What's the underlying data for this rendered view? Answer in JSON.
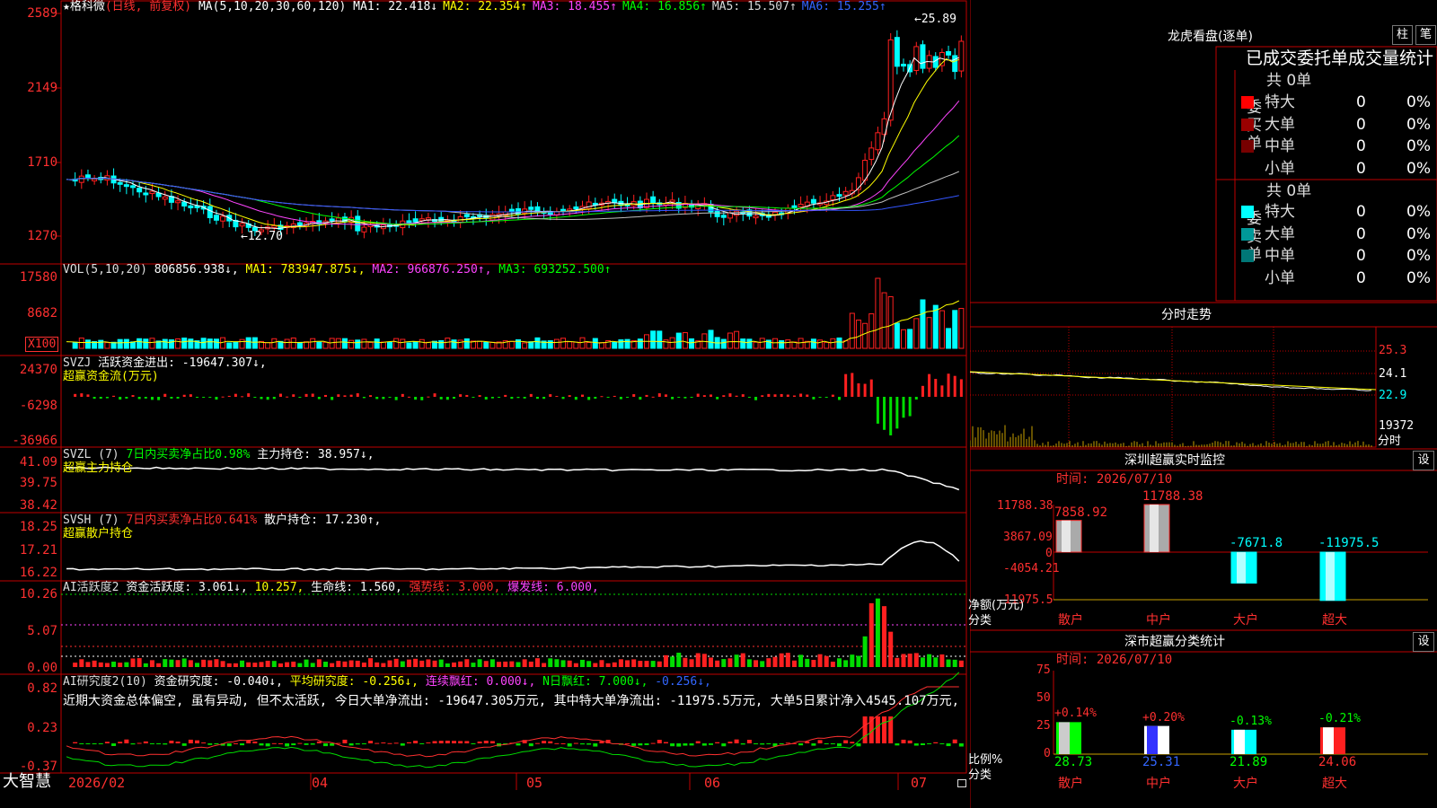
{
  "main": {
    "title": "★格科微",
    "mode": "(日线, 前复权)",
    "ma_params": "MA(5,10,20,30,60,120)",
    "ma": [
      {
        "label": "MA1: 22.418↓",
        "color": "#ffffff"
      },
      {
        "label": "MA2: 22.354↑",
        "color": "#ffff00"
      },
      {
        "label": "MA3: 18.455↑",
        "color": "#ff44ff"
      },
      {
        "label": "MA4: 16.856↑",
        "color": "#00ff00"
      },
      {
        "label": "MA5: 15.507↑",
        "color": "#d8d8d8"
      },
      {
        "label": "MA6: 15.255↑",
        "color": "#3366ff"
      }
    ],
    "axis": [
      "2589",
      "2149",
      "1710",
      "1270"
    ],
    "high_label": "←25.89",
    "low_label": "←12.70"
  },
  "vol": {
    "title": "VOL(5,10,20)",
    "value": "806856.938↓,",
    "ma1": "MA1: 783947.875↓,",
    "ma2": "MA2: 966876.250↑,",
    "ma3": "MA3: 693252.500↑",
    "axis": [
      "17580",
      "8682"
    ],
    "unit": "X100"
  },
  "svzj": {
    "title": "SVZJ",
    "text": "活跃资金进出: -19647.307↓,",
    "sub": "超赢资金流(万元)",
    "axis": [
      "24370",
      "-6298",
      "-36966"
    ]
  },
  "svzl": {
    "title": "SVZL (7)",
    "text1": "7日内买卖净占比0.98%",
    "text2": "主力持仓: 38.957↓,",
    "sub": "超赢主力持仓",
    "axis": [
      "41.09",
      "39.75",
      "38.42"
    ]
  },
  "svsh": {
    "title": "SVSH (7)",
    "text1": "7日内买卖净占比0.641%",
    "text2": "散户持仓: 17.230↑,",
    "sub": "超赢散户持仓",
    "axis": [
      "18.25",
      "17.21",
      "16.22"
    ]
  },
  "ai1": {
    "title": "AI活跃度2",
    "t1": "资金活跃度: 3.061↓,",
    "t2": "10.257,",
    "t3": "生命线: 1.560,",
    "t4": "强势线: 3.000,",
    "t5": "爆发线: 6.000,",
    "axis": [
      "10.26",
      "5.07",
      "0.00"
    ]
  },
  "ai2": {
    "title": "AI研究度2(10)",
    "t1": "资金研究度: -0.040↓,",
    "t2": "平均研究度: -0.256↓,",
    "t3": "连续飘红: 0.000↓,",
    "t4": "N日飘红: 7.000↓,",
    "t5": "-0.256↓,",
    "comment": "近期大资金总体偏空, 虽有异动, 但不太活跃, 今日大单净流出: -19647.305万元, 其中特大单净流出: -11975.5万元, 大单5日累计净入4545.107万元, ",
    "axis": [
      "0.82",
      "0.23",
      "-0.37"
    ]
  },
  "xaxis": [
    "2026/02",
    "04",
    "05",
    "06",
    "07"
  ],
  "brand": "大智慧",
  "lhb": {
    "title": "龙虎看盘(逐单)",
    "btn1": "柱",
    "btn2": "笔",
    "tabs": "已成交委托单成交量统计",
    "buy": {
      "side": "委买单",
      "total": "共 0单",
      "rows": [
        {
          "name": "特大",
          "count": "0",
          "pct": "0%",
          "color": "#ff0000"
        },
        {
          "name": "大单",
          "count": "0",
          "pct": "0%",
          "color": "#990000"
        },
        {
          "name": "中单",
          "count": "0",
          "pct": "0%",
          "color": "#770000"
        },
        {
          "name": "小单",
          "count": "0",
          "pct": "0%",
          "color": ""
        }
      ]
    },
    "sell": {
      "side": "委卖单",
      "total": "共 0单",
      "rows": [
        {
          "name": "特大",
          "count": "0",
          "pct": "0%",
          "color": "#00ffff"
        },
        {
          "name": "大单",
          "count": "0",
          "pct": "0%",
          "color": "#009999"
        },
        {
          "name": "中单",
          "count": "0",
          "pct": "0%",
          "color": "#007777"
        },
        {
          "name": "小单",
          "count": "0",
          "pct": "0%",
          "color": ""
        }
      ]
    }
  },
  "intraday": {
    "title": "分时走势",
    "axis": [
      "25.3",
      "24.1",
      "22.9",
      "19372"
    ],
    "unit": "分时"
  },
  "szmon": {
    "title": "深圳超赢实时监控",
    "btn": "设",
    "time": "时间: 2026/07/10",
    "yaxis": [
      "11788.38",
      "3867.09",
      "0",
      "-4054.21",
      "-11975.5"
    ],
    "ylabel": "净额(万元)",
    "xtitle": "分类",
    "cats": [
      "散户",
      "中户",
      "大户",
      "超大"
    ],
    "vals": [
      "7858.92",
      "11788.38",
      "-7671.8",
      "-11975.5"
    ]
  },
  "szcls": {
    "title": "深市超赢分类统计",
    "btn": "设",
    "time": "时间: 2026/07/10",
    "yaxis": [
      "75",
      "50",
      "25",
      "0"
    ],
    "ylabel": "比例%",
    "xtitle": "分类",
    "cats": [
      "散户",
      "中户",
      "大户",
      "超大"
    ],
    "pct": [
      "28.73",
      "25.31",
      "21.89",
      "24.06"
    ],
    "chg": [
      "+0.14%",
      "+0.20%",
      "-0.13%",
      "-0.21%"
    ]
  },
  "chart_data": [
    {
      "type": "bar",
      "title": "深圳超赢实时监控",
      "ylabel": "净额(万元)",
      "xlabel": "分类",
      "categories": [
        "散户",
        "中户",
        "大户",
        "超大"
      ],
      "values": [
        7858.92,
        11788.38,
        -7671.8,
        -11975.5
      ],
      "ylim": [
        -11975.5,
        11788.38
      ]
    },
    {
      "type": "bar",
      "title": "深市超赢分类统计",
      "ylabel": "比例%",
      "xlabel": "分类",
      "categories": [
        "散户",
        "中户",
        "大户",
        "超大"
      ],
      "values": [
        28.73,
        25.31,
        21.89,
        24.06
      ],
      "ylim": [
        0,
        75
      ]
    }
  ]
}
